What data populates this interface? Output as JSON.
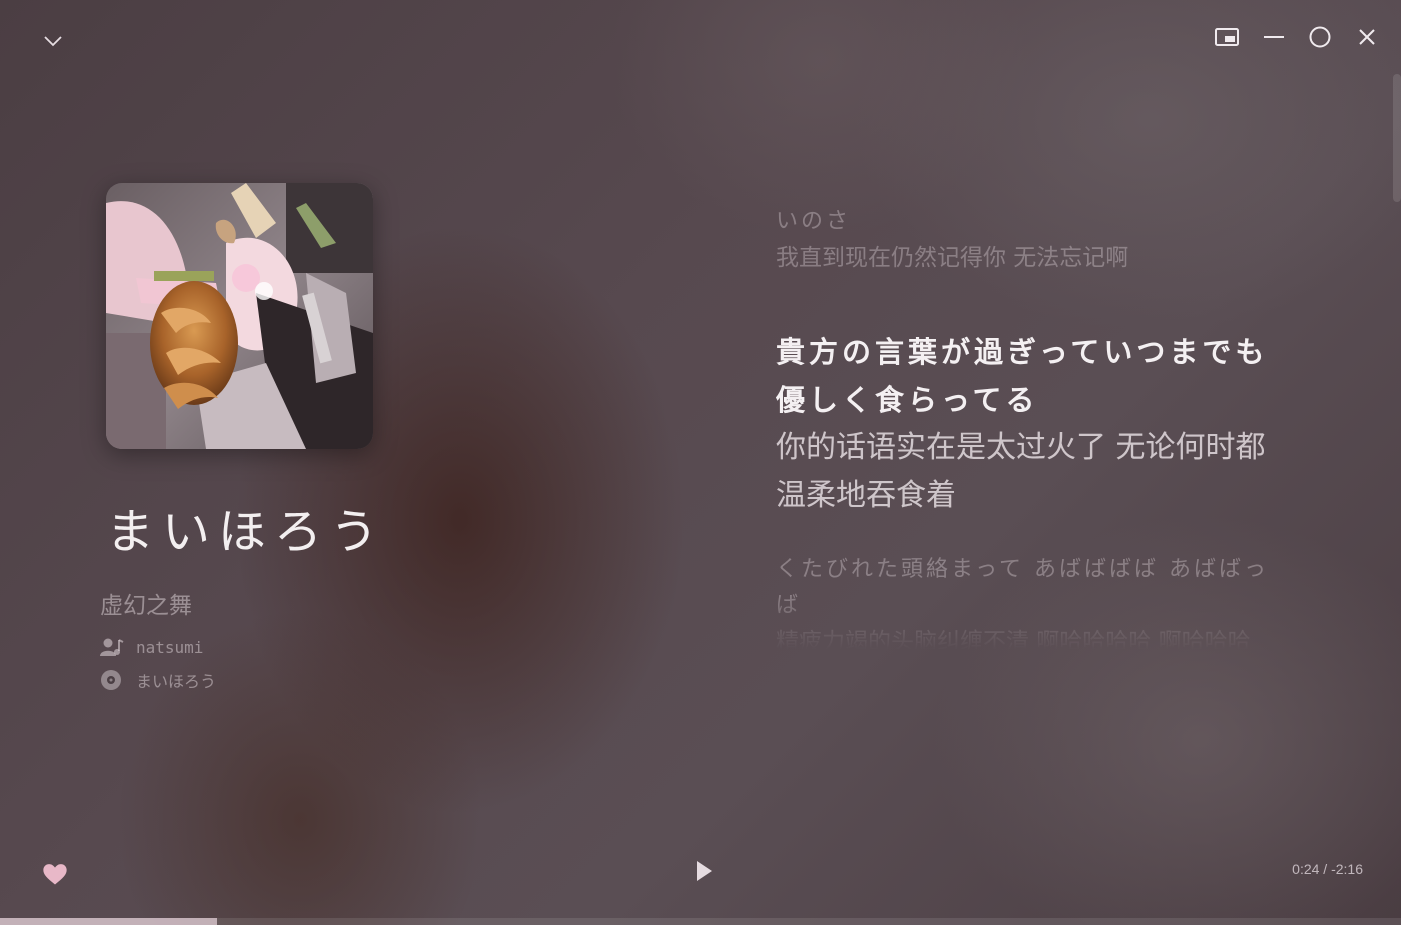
{
  "window": {
    "controls": [
      "collapse",
      "picture-in-picture",
      "minimize",
      "maximize",
      "close"
    ]
  },
  "song": {
    "title": "まいほろう",
    "subtitle": "虚幻之舞",
    "artist": "natsumi",
    "album": "まいほろう"
  },
  "icons": {
    "collapse": "chevron-down-icon",
    "pip": "picture-in-picture-icon",
    "minimize": "minimize-icon",
    "maximize": "maximize-icon",
    "close": "close-icon",
    "artist": "artist-icon",
    "album": "album-disc-icon",
    "like": "heart-icon",
    "play": "play-icon"
  },
  "lyrics": [
    {
      "orig": "いのさ",
      "trans": "我直到现在仍然记得你  无法忘记啊",
      "state": "past"
    },
    {
      "orig": "貴方の言葉が過ぎっていつまでも優しく食らってる",
      "trans": "你的话语实在是太过火了  无论何时都温柔地吞食着",
      "state": "current"
    },
    {
      "orig": "くたびれた頭絡まって  あばばばば  あばばっば",
      "trans": "精疲力竭的头脑纠缠不清  啊哈哈哈哈  啊哈哈哈",
      "state": "next"
    }
  ],
  "player": {
    "time": "0:24 / -2:16",
    "progress": 0.155,
    "liked": true
  },
  "colors": {
    "accent": "#e2cdd6",
    "heart": "#e8b8c8"
  }
}
